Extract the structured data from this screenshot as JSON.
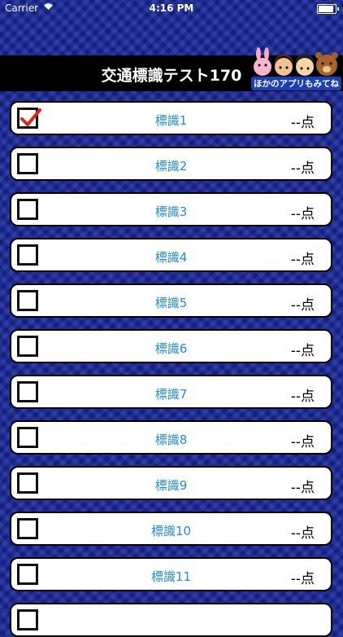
{
  "status_bar": {
    "carrier": "Carrier",
    "time": "4:16 PM",
    "battery_level": 0.8
  },
  "header": {
    "title": "交通標識テスト170"
  },
  "banner": {
    "text": "ほかのアプリもみてね"
  },
  "checkbox_states": [
    true,
    false,
    false,
    false,
    false,
    false,
    false,
    false,
    false,
    false,
    false,
    false
  ],
  "items": [
    {
      "label": "標識1",
      "score": "--点"
    },
    {
      "label": "標識2",
      "score": "--点"
    },
    {
      "label": "標識3",
      "score": "--点"
    },
    {
      "label": "標識4",
      "score": "--点"
    },
    {
      "label": "標識5",
      "score": "--点"
    },
    {
      "label": "標識6",
      "score": "--点"
    },
    {
      "label": "標識7",
      "score": "--点"
    },
    {
      "label": "標識8",
      "score": "--点"
    },
    {
      "label": "標識9",
      "score": "--点"
    },
    {
      "label": "標識10",
      "score": "--点"
    },
    {
      "label": "標識11",
      "score": "--点"
    },
    {
      "label": "",
      "score": ""
    }
  ],
  "colors": {
    "background": "#1b2a8c",
    "label": "#1f8ed6",
    "check": "#e0221a"
  }
}
